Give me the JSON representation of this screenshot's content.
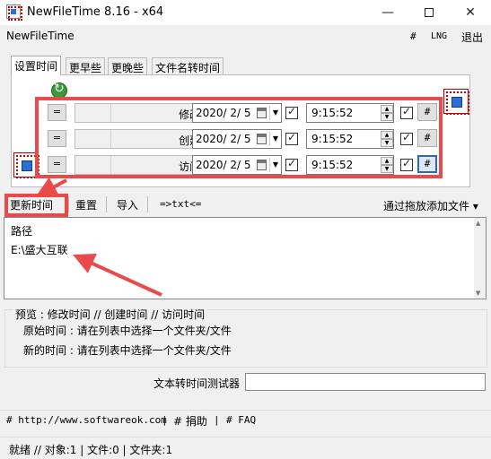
{
  "window": {
    "title": "NewFileTime 8.16 - x64",
    "min_glyph": "—",
    "close_glyph": "✕"
  },
  "menubar": {
    "app_name": "NewFileTime",
    "hash": "#",
    "lng": "LNG",
    "exit": "退出"
  },
  "tabs": [
    {
      "label": "设置时间",
      "active": true
    },
    {
      "label": "更早些",
      "active": false
    },
    {
      "label": "更晚些",
      "active": false
    },
    {
      "label": "文件名转时间",
      "active": false
    }
  ],
  "time_rows": [
    {
      "eq": "=",
      "label": "修改时间 :",
      "date": "2020/  2/  5",
      "time": "9:15:52",
      "hash": "#",
      "checked": true
    },
    {
      "eq": "=",
      "label": "创建时间 :",
      "date": "2020/  2/  5",
      "time": "9:15:52",
      "hash": "#",
      "checked": true
    },
    {
      "eq": "=",
      "label": "访问时间 :",
      "date": "2020/  2/  5",
      "time": "9:15:52",
      "hash": "#",
      "checked": true
    }
  ],
  "toolbar": {
    "update": "更新时间",
    "reset": "重置",
    "import": "导入",
    "txt": "=>txt<=",
    "add_by_drag": "通过拖放添加文件 ▾"
  },
  "list": {
    "header": "路径",
    "items": [
      "E:\\盛大互联"
    ]
  },
  "preview": {
    "head": "预览 :   修改时间    //   创建时间    //   访问时间",
    "original": "原始时间 : 请在列表中选择一个文件夹/文件",
    "new": "新的时间 : 请在列表中选择一个文件夹/文件"
  },
  "tester": {
    "label": "文本转时间测试器",
    "value": ""
  },
  "footer": {
    "link_site": "# http://www.softwareok.com",
    "sep1": "|",
    "donate": "# 捐助",
    "sep2": "|",
    "faq": "# FAQ"
  },
  "status": {
    "text": "就绪 // 对象:1 | 文件:0  | 文件夹:1"
  },
  "colors": {
    "highlight": "#e94a4a",
    "arrow": "#e94a4a",
    "window_bg": "#f0f0f0"
  }
}
